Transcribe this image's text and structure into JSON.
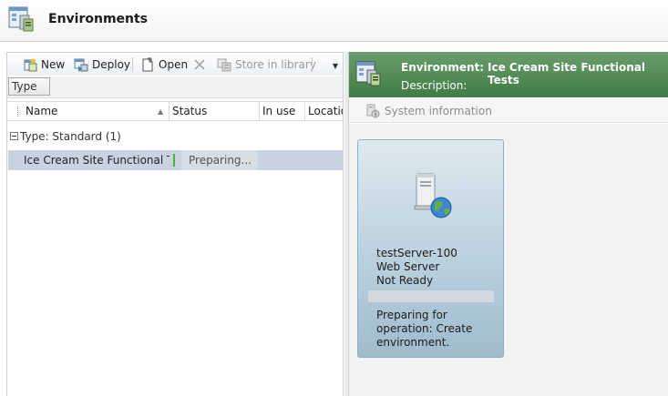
{
  "header": {
    "title": "Environments"
  },
  "toolbar": {
    "new_label": "New",
    "deploy_label": "Deploy",
    "open_label": "Open",
    "store_label": "Store in library"
  },
  "grouping": {
    "chip_label": "Type"
  },
  "columns": {
    "name": "Name",
    "status": "Status",
    "in_use": "In use",
    "location": "Locatio"
  },
  "group": {
    "label": "Type: Standard (1)"
  },
  "rows": [
    {
      "name": "Ice Cream Site Functional T...",
      "status": "Preparing..."
    }
  ],
  "environment": {
    "environment_key": "Environment:",
    "environment_value": "Ice Cream Site Functional Tests",
    "description_key": "Description:",
    "description_value": "",
    "system_info_label": "System information"
  },
  "server": {
    "name": "testServer-100",
    "role": "Web Server",
    "state": "Not Ready",
    "message": "Preparing for operation: Create environment."
  },
  "colors": {
    "banner": "#4a854e",
    "selected_row": "#c7d3e0",
    "status_indicator": "#3bbb45",
    "card": "#b7cfdd"
  }
}
